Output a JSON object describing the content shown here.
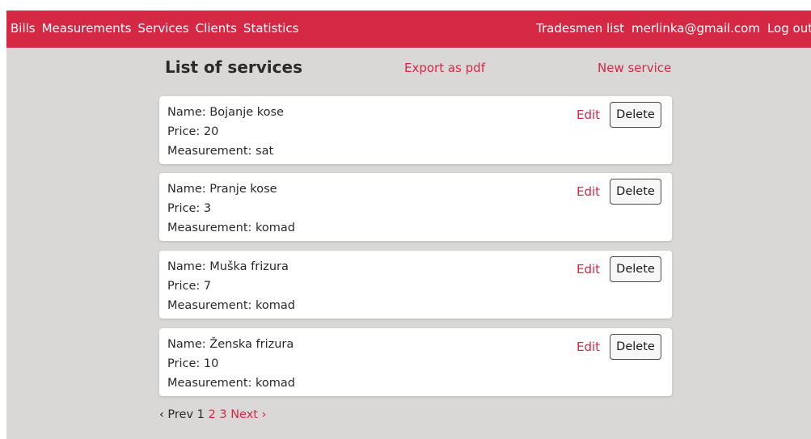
{
  "nav": {
    "left": [
      "Bills",
      "Measurements",
      "Services",
      "Clients",
      "Statistics"
    ],
    "tradesmen": "Tradesmen list",
    "email": "merlinka@gmail.com",
    "logout": "Log out"
  },
  "page": {
    "title": "List of services",
    "export": "Export as pdf",
    "new": "New service"
  },
  "services": [
    {
      "name": "Name: Bojanje kose",
      "price": "Price: 20",
      "measurement": "Measurement: sat"
    },
    {
      "name": "Name: Pranje kose",
      "price": "Price: 3",
      "measurement": "Measurement: komad"
    },
    {
      "name": "Name: Muška frizura",
      "price": "Price: 7",
      "measurement": "Measurement: komad"
    },
    {
      "name": "Name: Ženska frizura",
      "price": "Price: 10",
      "measurement": "Measurement: komad"
    }
  ],
  "actions": {
    "edit": "Edit",
    "delete": "Delete"
  },
  "pagination": {
    "prev": "‹ Prev",
    "current": "1",
    "pages": [
      "2",
      "3"
    ],
    "next": "Next ›"
  },
  "colors": {
    "accent": "#d42845",
    "background": "#d9d8d7"
  }
}
